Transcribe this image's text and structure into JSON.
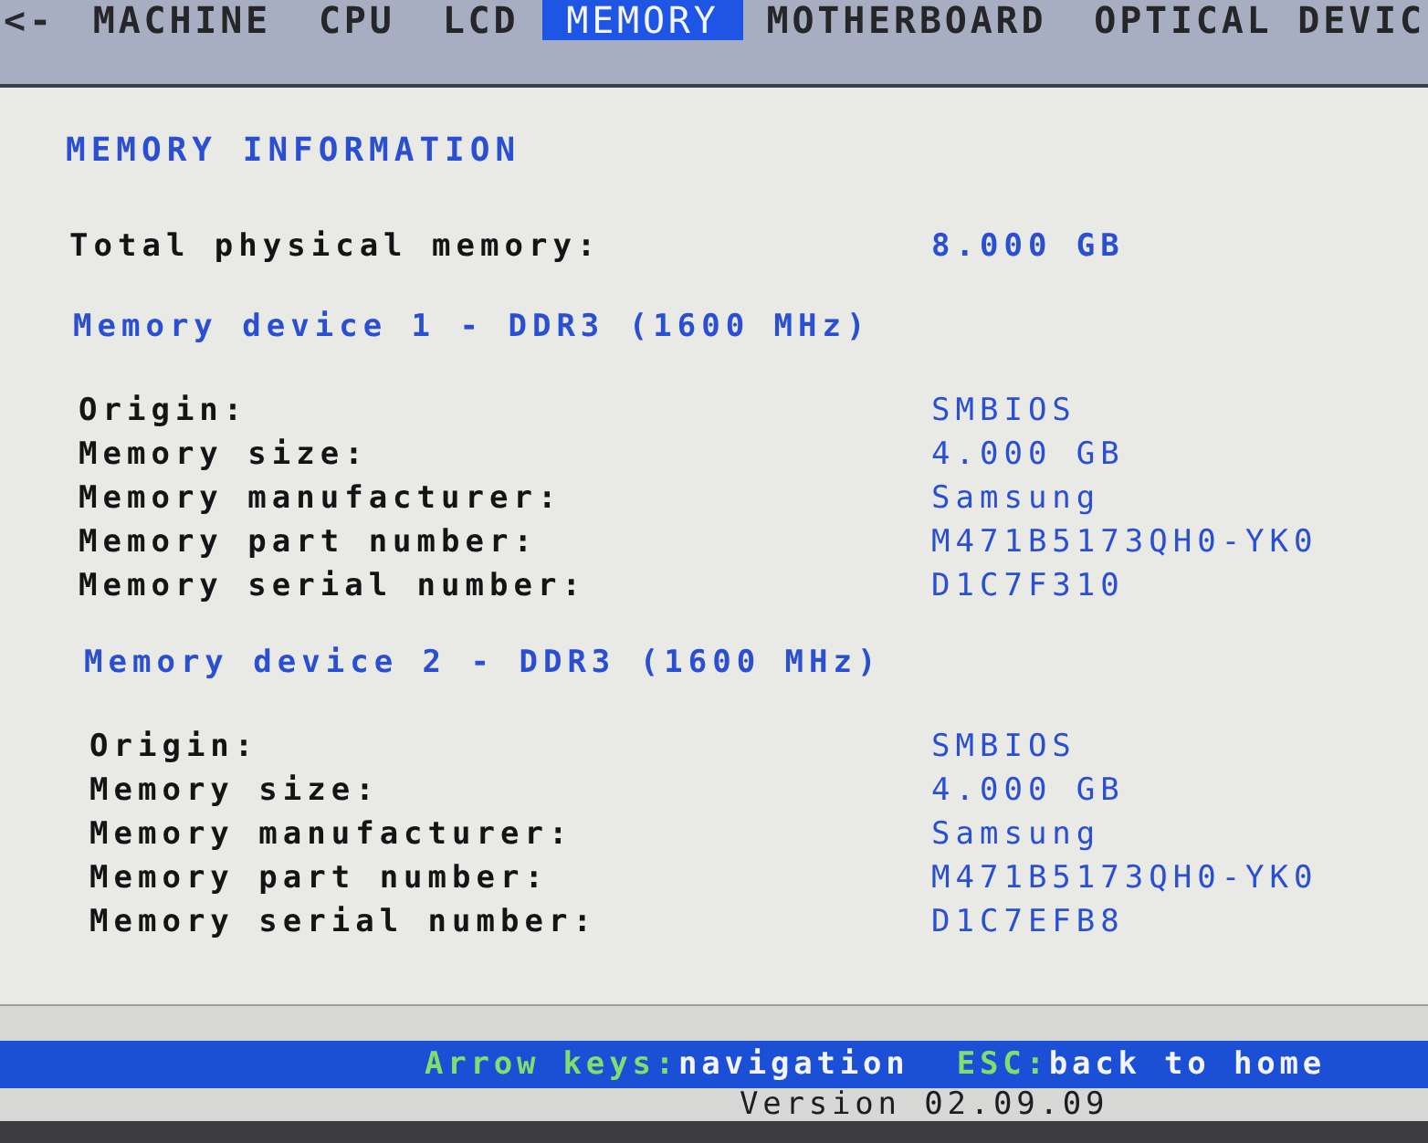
{
  "tabs_prev": "<-",
  "tabs": [
    {
      "label": "MACHINE",
      "selected": false
    },
    {
      "label": "CPU",
      "selected": false
    },
    {
      "label": "LCD",
      "selected": false
    },
    {
      "label": "MEMORY",
      "selected": true
    },
    {
      "label": "MOTHERBOARD",
      "selected": false
    },
    {
      "label": "OPTICAL DEVIC",
      "selected": false
    }
  ],
  "title": "MEMORY INFORMATION",
  "total": {
    "label": "Total physical memory:",
    "value": "8.000 GB"
  },
  "devices": [
    {
      "heading": "Memory device 1 - DDR3 (1600 MHz)",
      "fields": [
        {
          "label": "Origin:",
          "value": "SMBIOS"
        },
        {
          "label": "Memory size:",
          "value": "4.000 GB"
        },
        {
          "label": "Memory manufacturer:",
          "value": "Samsung"
        },
        {
          "label": "Memory part number:",
          "value": "M471B5173QH0-YK0"
        },
        {
          "label": "Memory serial number:",
          "value": "D1C7F310"
        }
      ]
    },
    {
      "heading": "Memory device 2 - DDR3 (1600 MHz)",
      "fields": [
        {
          "label": "Origin:",
          "value": "SMBIOS"
        },
        {
          "label": "Memory size:",
          "value": "4.000 GB"
        },
        {
          "label": "Memory manufacturer:",
          "value": "Samsung"
        },
        {
          "label": "Memory part number:",
          "value": "M471B5173QH0-YK0"
        },
        {
          "label": "Memory serial number:",
          "value": "D1C7EFB8"
        }
      ]
    }
  ],
  "footer": {
    "hints": [
      {
        "key": "Arrow keys:",
        "action": "navigation"
      },
      {
        "key": "ESC:",
        "action": "back to home"
      }
    ]
  },
  "version": "Version 02.09.09"
}
